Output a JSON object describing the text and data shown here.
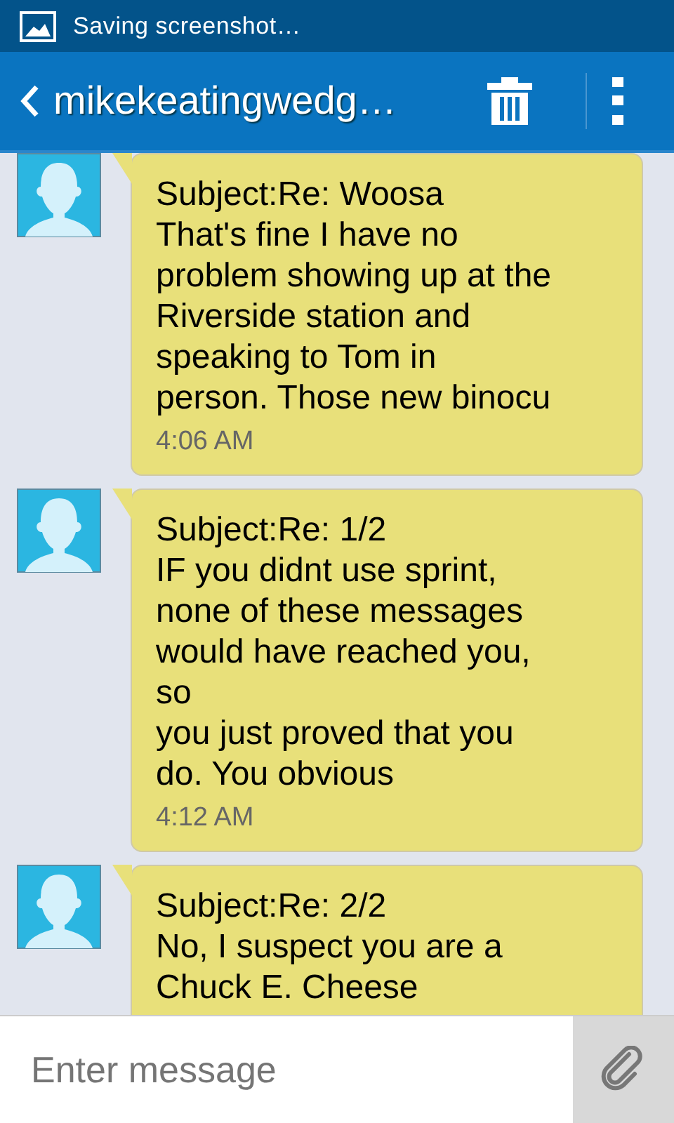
{
  "status_bar": {
    "notification": "Saving screenshot…"
  },
  "app_bar": {
    "title": "mikekeatingwedg…"
  },
  "messages": [
    {
      "subject": "Subject:Re: Woosa",
      "body": "That's fine I have no\nproblem showing up at the\nRiverside station and\nspeaking to Tom in\nperson. Those new binocu",
      "time": "4:06 AM"
    },
    {
      "subject": "Subject:Re: 1/2",
      "body": "IF you didnt use sprint,\nnone of these messages\nwould have reached you,\nso\nyou just proved that you\ndo. You obvious",
      "time": "4:12 AM"
    },
    {
      "subject": "Subject:Re: 2/2",
      "body": "No, I suspect you are a\nChuck E. Cheese"
    }
  ],
  "composer": {
    "placeholder": "Enter message"
  }
}
